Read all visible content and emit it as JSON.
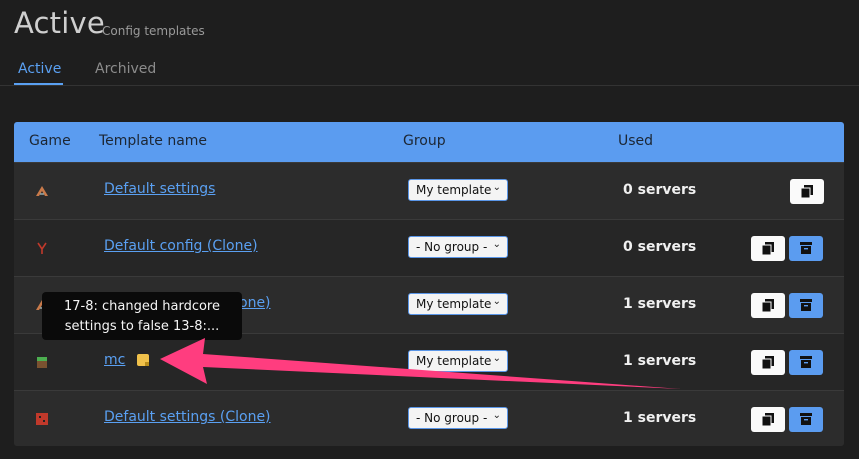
{
  "header": {
    "title": "Active",
    "subtitle": "Config templates"
  },
  "tabs": [
    {
      "label": "Active"
    },
    {
      "label": "Archived"
    }
  ],
  "table": {
    "columns": {
      "game": "Game",
      "name": "Template name",
      "group": "Group",
      "used": "Used"
    },
    "rows": [
      {
        "game_icon": "ark-icon",
        "name": "Default settings",
        "group": "My template",
        "used": "0 servers"
      },
      {
        "game_icon": "rust-icon",
        "name": "Default config (Clone)",
        "group": "- No group -",
        "used": "0 servers"
      },
      {
        "game_icon": "ark-icon",
        "name": "Default settings (Clone)",
        "group": "My template",
        "used": "1 servers"
      },
      {
        "game_icon": "minecraft-icon",
        "name": "mc",
        "group": "My template",
        "used": "1 servers"
      },
      {
        "game_icon": "game-icon",
        "name": "Default settings (Clone)",
        "group": "- No group -",
        "used": "1 servers"
      }
    ]
  },
  "tooltip": {
    "line1": "17-8: changed hardcore",
    "line2": "settings to false 13-8:..."
  },
  "colors": {
    "accent": "#5b9cf0",
    "annotation_arrow": "#ff3d7f",
    "note": "#f0c14b"
  }
}
